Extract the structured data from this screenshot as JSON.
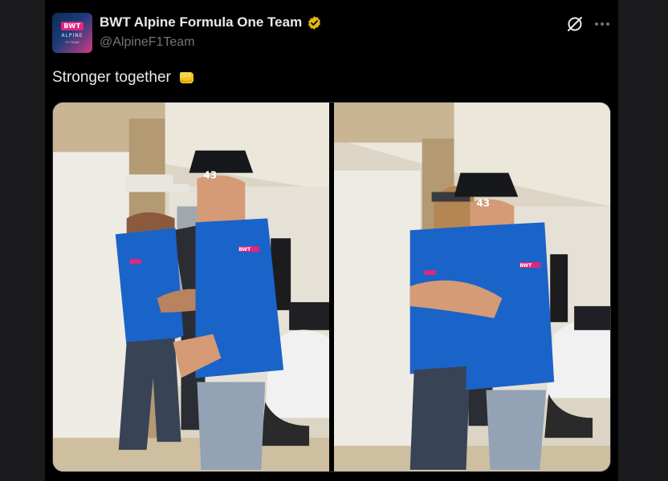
{
  "account": {
    "display_name": "BWT Alpine Formula One Team",
    "handle": "@AlpineF1Team",
    "verified": true,
    "verified_color": "#e2b719",
    "avatar": {
      "icon": "bwt-alpine-logo",
      "badge_text": "BWT",
      "brand_text": "ALPINE",
      "sub_text": "F1 TEAM"
    }
  },
  "tweet": {
    "text": "Stronger together",
    "emoji_icon": "oncoming-fist-icon"
  },
  "actions": {
    "grok_icon": "grok-icon",
    "more_icon": "more-dots-icon"
  },
  "media": {
    "photos": [
      {
        "id": "left",
        "car_number": "43",
        "shirt_sponsor": "BWT"
      },
      {
        "id": "right",
        "car_number": "43",
        "shirt_sponsor": "BWT"
      }
    ]
  },
  "colors": {
    "background": "#000000",
    "text_primary": "#e7e9ea",
    "text_secondary": "#71767b",
    "alpine_blue": "#1a63c9",
    "bwt_pink": "#e0267d"
  }
}
